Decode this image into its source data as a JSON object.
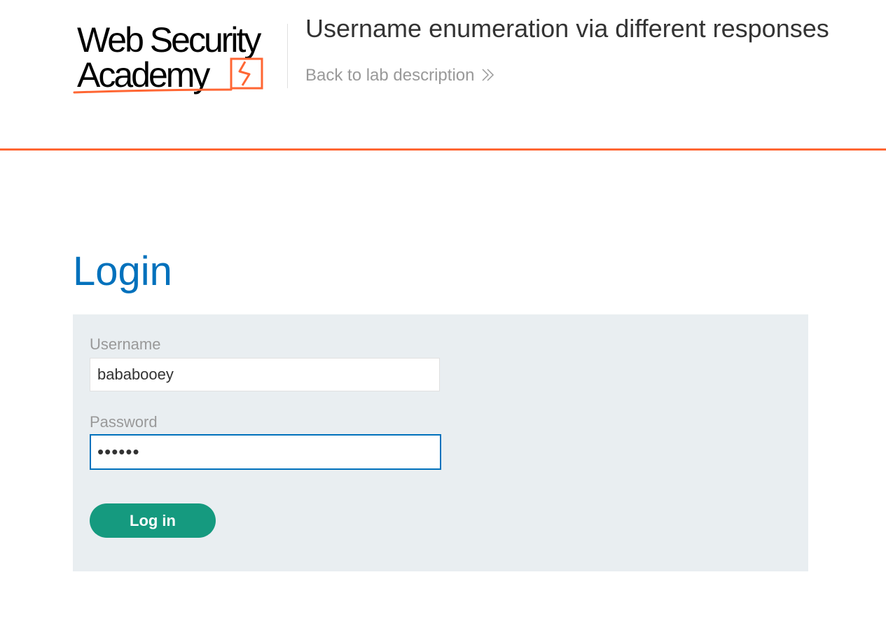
{
  "header": {
    "logo_line1": "Web Security",
    "logo_line2": "Academy",
    "lab_title": "Username enumeration via different responses",
    "back_link": "Back to lab description",
    "accent_color": "#ff6633"
  },
  "page": {
    "title": "Login"
  },
  "login_form": {
    "username_label": "Username",
    "username_value": "bababooey",
    "password_label": "Password",
    "password_value": "••••••",
    "submit_label": "Log in",
    "button_color": "#159a7f",
    "title_color": "#0071bc"
  }
}
